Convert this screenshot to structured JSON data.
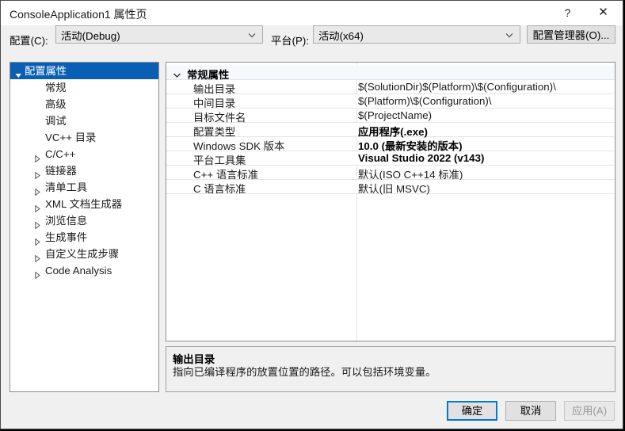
{
  "window": {
    "title": "ConsoleApplication1 属性页",
    "help_label": "?",
    "close_label": "✕"
  },
  "config_bar": {
    "configuration_label": "配置(C):",
    "configuration_value": "活动(Debug)",
    "platform_label": "平台(P):",
    "platform_value": "活动(x64)",
    "config_manager_label": "配置管理器(O)..."
  },
  "tree": {
    "items": [
      {
        "label": "配置属性",
        "indent": 0,
        "arrow": "expanded",
        "selected": true
      },
      {
        "label": "常规",
        "indent": 1,
        "arrow": "none",
        "selected": false
      },
      {
        "label": "高级",
        "indent": 1,
        "arrow": "none",
        "selected": false
      },
      {
        "label": "调试",
        "indent": 1,
        "arrow": "none",
        "selected": false
      },
      {
        "label": "VC++ 目录",
        "indent": 1,
        "arrow": "none",
        "selected": false
      },
      {
        "label": "C/C++",
        "indent": 1,
        "arrow": "collapsed",
        "selected": false
      },
      {
        "label": "链接器",
        "indent": 1,
        "arrow": "collapsed",
        "selected": false
      },
      {
        "label": "清单工具",
        "indent": 1,
        "arrow": "collapsed",
        "selected": false
      },
      {
        "label": "XML 文档生成器",
        "indent": 1,
        "arrow": "collapsed",
        "selected": false
      },
      {
        "label": "浏览信息",
        "indent": 1,
        "arrow": "collapsed",
        "selected": false
      },
      {
        "label": "生成事件",
        "indent": 1,
        "arrow": "collapsed",
        "selected": false
      },
      {
        "label": "自定义生成步骤",
        "indent": 1,
        "arrow": "collapsed",
        "selected": false
      },
      {
        "label": "Code Analysis",
        "indent": 1,
        "arrow": "collapsed",
        "selected": false
      }
    ]
  },
  "property_grid": {
    "category": "常规属性",
    "rows": [
      {
        "name": "输出目录",
        "value": "$(SolutionDir)$(Platform)\\$(Configuration)\\",
        "bold": false
      },
      {
        "name": "中间目录",
        "value": "$(Platform)\\$(Configuration)\\",
        "bold": false
      },
      {
        "name": "目标文件名",
        "value": "$(ProjectName)",
        "bold": false
      },
      {
        "name": "配置类型",
        "value": "应用程序(.exe)",
        "bold": true
      },
      {
        "name": "Windows SDK 版本",
        "value": "10.0 (最新安装的版本)",
        "bold": true
      },
      {
        "name": "平台工具集",
        "value": "Visual Studio 2022 (v143)",
        "bold": true
      },
      {
        "name": "C++ 语言标准",
        "value": "默认(ISO C++14 标准)",
        "bold": false
      },
      {
        "name": "C 语言标准",
        "value": "默认(旧 MSVC)",
        "bold": false
      }
    ]
  },
  "description": {
    "title": "输出目录",
    "text": "指向已编译程序的放置位置的路径。可以包括环境变量。"
  },
  "footer": {
    "ok_label": "确定",
    "cancel_label": "取消",
    "apply_label": "应用(A)"
  },
  "colors": {
    "selection": "#0a5fb4",
    "focus_border": "#0078d7",
    "category_row": "#f6f9fc"
  }
}
